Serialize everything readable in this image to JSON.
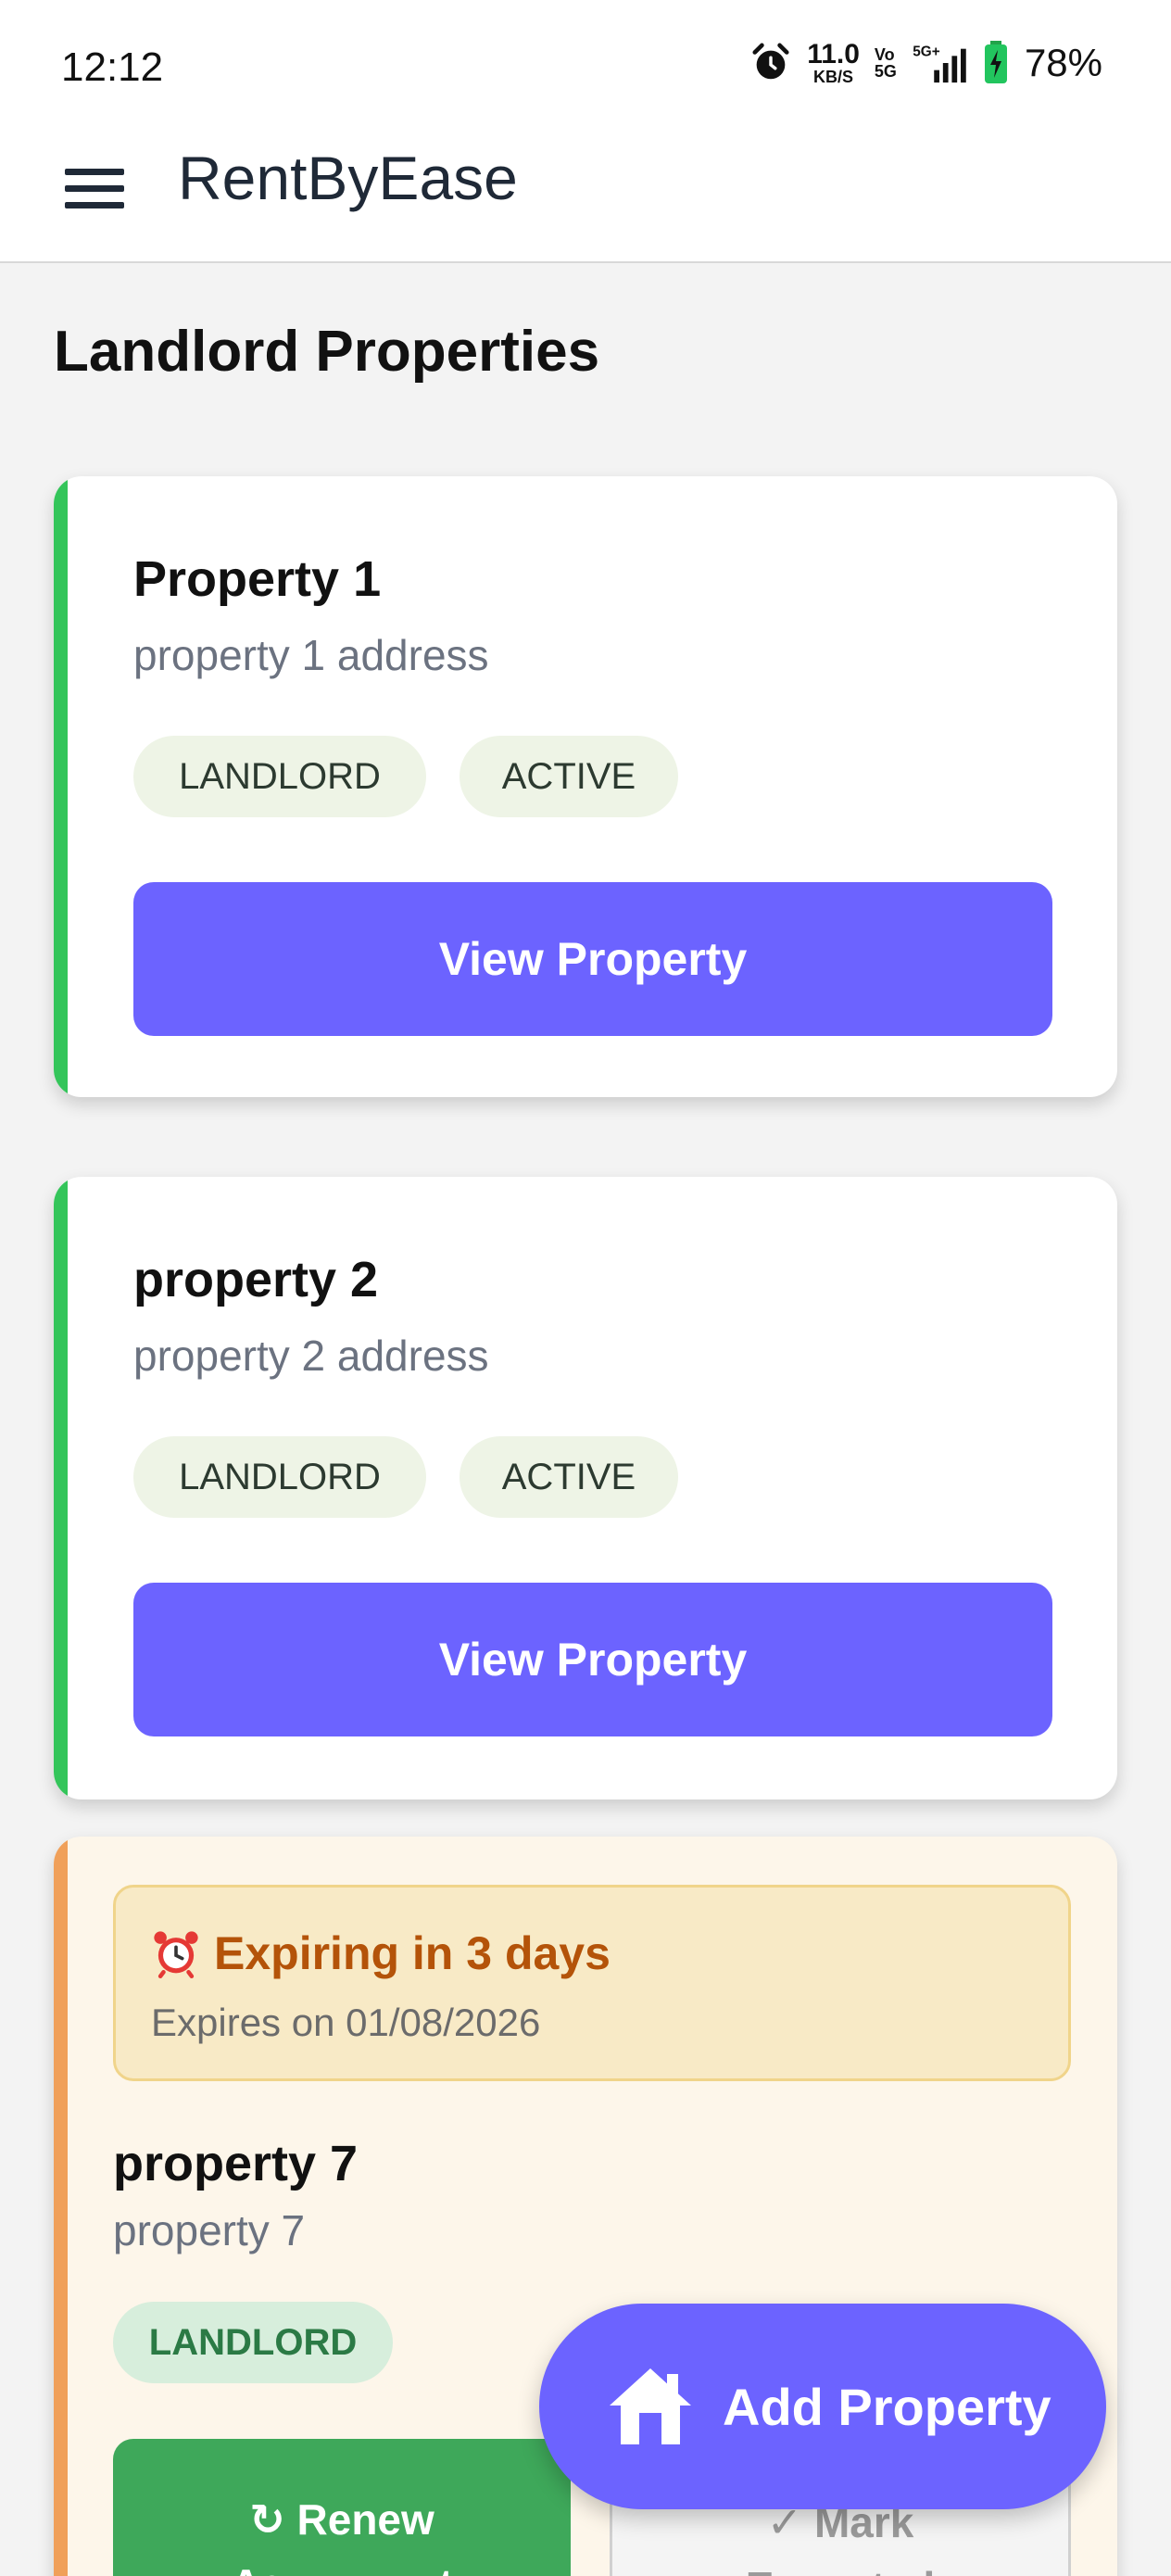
{
  "status_bar": {
    "time": "12:12",
    "net_speed_value": "11.0",
    "net_speed_unit": "KB/S",
    "volte_top": "Vo",
    "volte_bottom": "5G",
    "network": "5G+",
    "battery": "78%"
  },
  "app_bar": {
    "title": "RentByEase",
    "menu_icon": "hamburger-menu-icon"
  },
  "page": {
    "title": "Landlord Properties"
  },
  "properties": [
    {
      "name": "Property 1",
      "address": "property 1 address",
      "role": "LANDLORD",
      "status": "ACTIVE",
      "button": "View Property"
    },
    {
      "name": "property 2",
      "address": "property 2 address",
      "role": "LANDLORD",
      "status": "ACTIVE",
      "button": "View Property"
    }
  ],
  "expiring_property": {
    "expiry_icon": "alarm-clock-emoji",
    "expiry_title": "Expiring in 3 days",
    "expiry_date": "Expires on 01/08/2026",
    "name": "property 7",
    "address": "property 7",
    "role": "LANDLORD",
    "renew_label": "↻ Renew",
    "renew_label_line2": "Agreement",
    "mark_label": "✓ Mark",
    "mark_label_line2": "Expected"
  },
  "fab": {
    "label": "Add Property",
    "icon": "home-icon"
  },
  "colors": {
    "primary": "#6c63ff",
    "active_accent": "#34c55a",
    "expiring_accent": "#f0a05a",
    "renew_green": "#3ea85a"
  }
}
